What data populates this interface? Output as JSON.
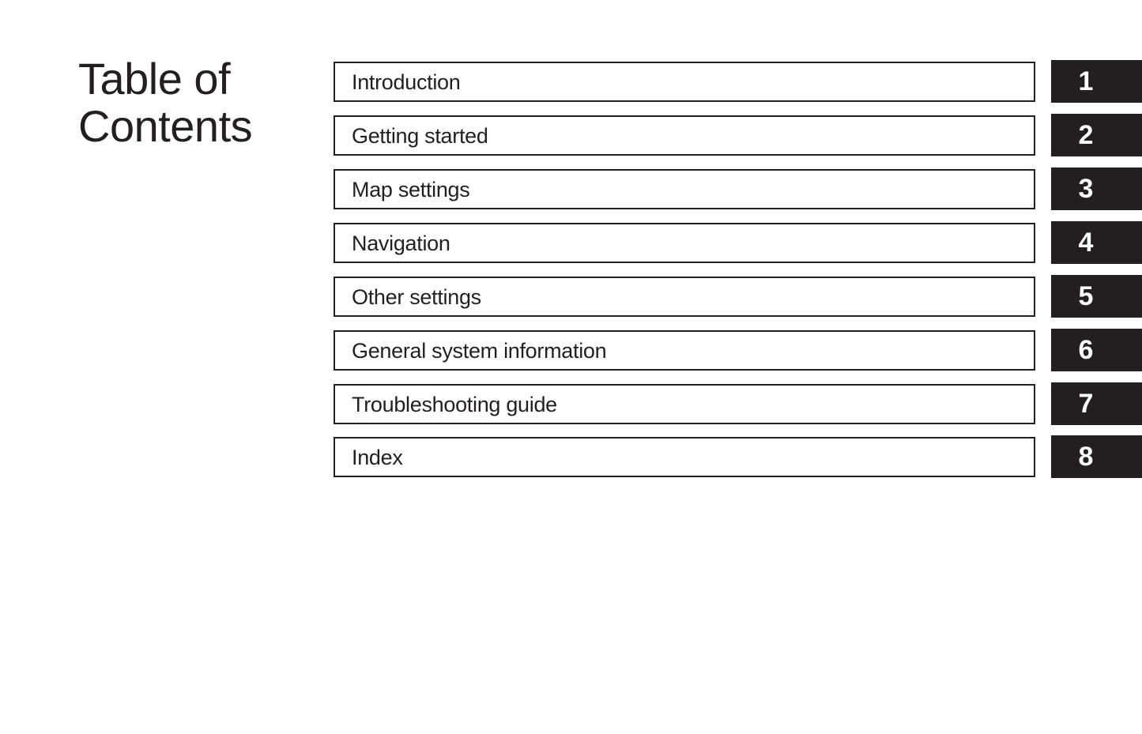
{
  "page": {
    "title_line1": "Table of",
    "title_line2": "Contents"
  },
  "toc": {
    "entries": [
      {
        "label": "Introduction",
        "number": "1"
      },
      {
        "label": "Getting started",
        "number": "2"
      },
      {
        "label": "Map settings",
        "number": "3"
      },
      {
        "label": "Navigation",
        "number": "4"
      },
      {
        "label": "Other settings",
        "number": "5"
      },
      {
        "label": "General system information",
        "number": "6"
      },
      {
        "label": "Troubleshooting guide",
        "number": "7"
      },
      {
        "label": "Index",
        "number": "8"
      }
    ]
  },
  "colors": {
    "ink": "#231f20",
    "tab_background": "#231f20",
    "tab_text": "#ffffff",
    "page_background": "#ffffff"
  }
}
